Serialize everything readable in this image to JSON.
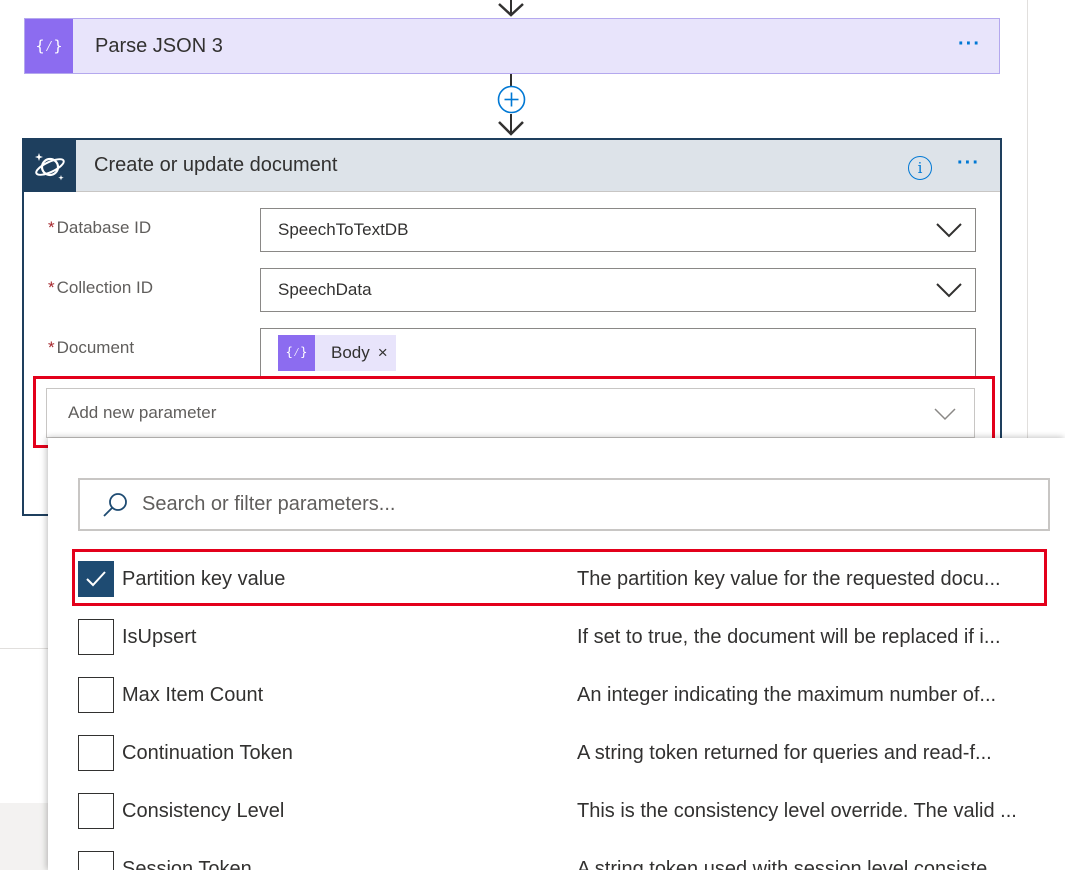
{
  "parse_card": {
    "icon": "braces-icon",
    "title": "Parse JSON 3",
    "menu": "···"
  },
  "create_card": {
    "icon": "cosmos-db-icon",
    "title": "Create or update document",
    "info": "i",
    "menu": "···",
    "required_marker": "*",
    "fields": {
      "database_label": "Database ID",
      "database_value": "SpeechToTextDB",
      "collection_label": "Collection ID",
      "collection_value": "SpeechData",
      "document_label": "Document",
      "document_token": "Body",
      "token_remove": "×"
    },
    "add_param": "Add new parameter"
  },
  "dropdown": {
    "search_placeholder": "Search or filter parameters...",
    "params": [
      {
        "name": "Partition key value",
        "desc": "The partition key value for the requested docu...",
        "checked": true
      },
      {
        "name": "IsUpsert",
        "desc": "If set to true, the document will be replaced if i...",
        "checked": false
      },
      {
        "name": "Max Item Count",
        "desc": "An integer indicating the maximum number of...",
        "checked": false
      },
      {
        "name": "Continuation Token",
        "desc": "A string token returned for queries and read-f...",
        "checked": false
      },
      {
        "name": "Consistency Level",
        "desc": "This is the consistency level override. The valid ...",
        "checked": false
      },
      {
        "name": "Session Token",
        "desc": "A string token used with session level consiste...",
        "checked": false
      }
    ]
  },
  "colors": {
    "accent": "#0078d4",
    "parse_icon_bg": "#8c6cf0",
    "cosmos_header": "#1e3f5e",
    "highlight_outline": "#e3001b",
    "checked_box": "#1e4b72"
  }
}
